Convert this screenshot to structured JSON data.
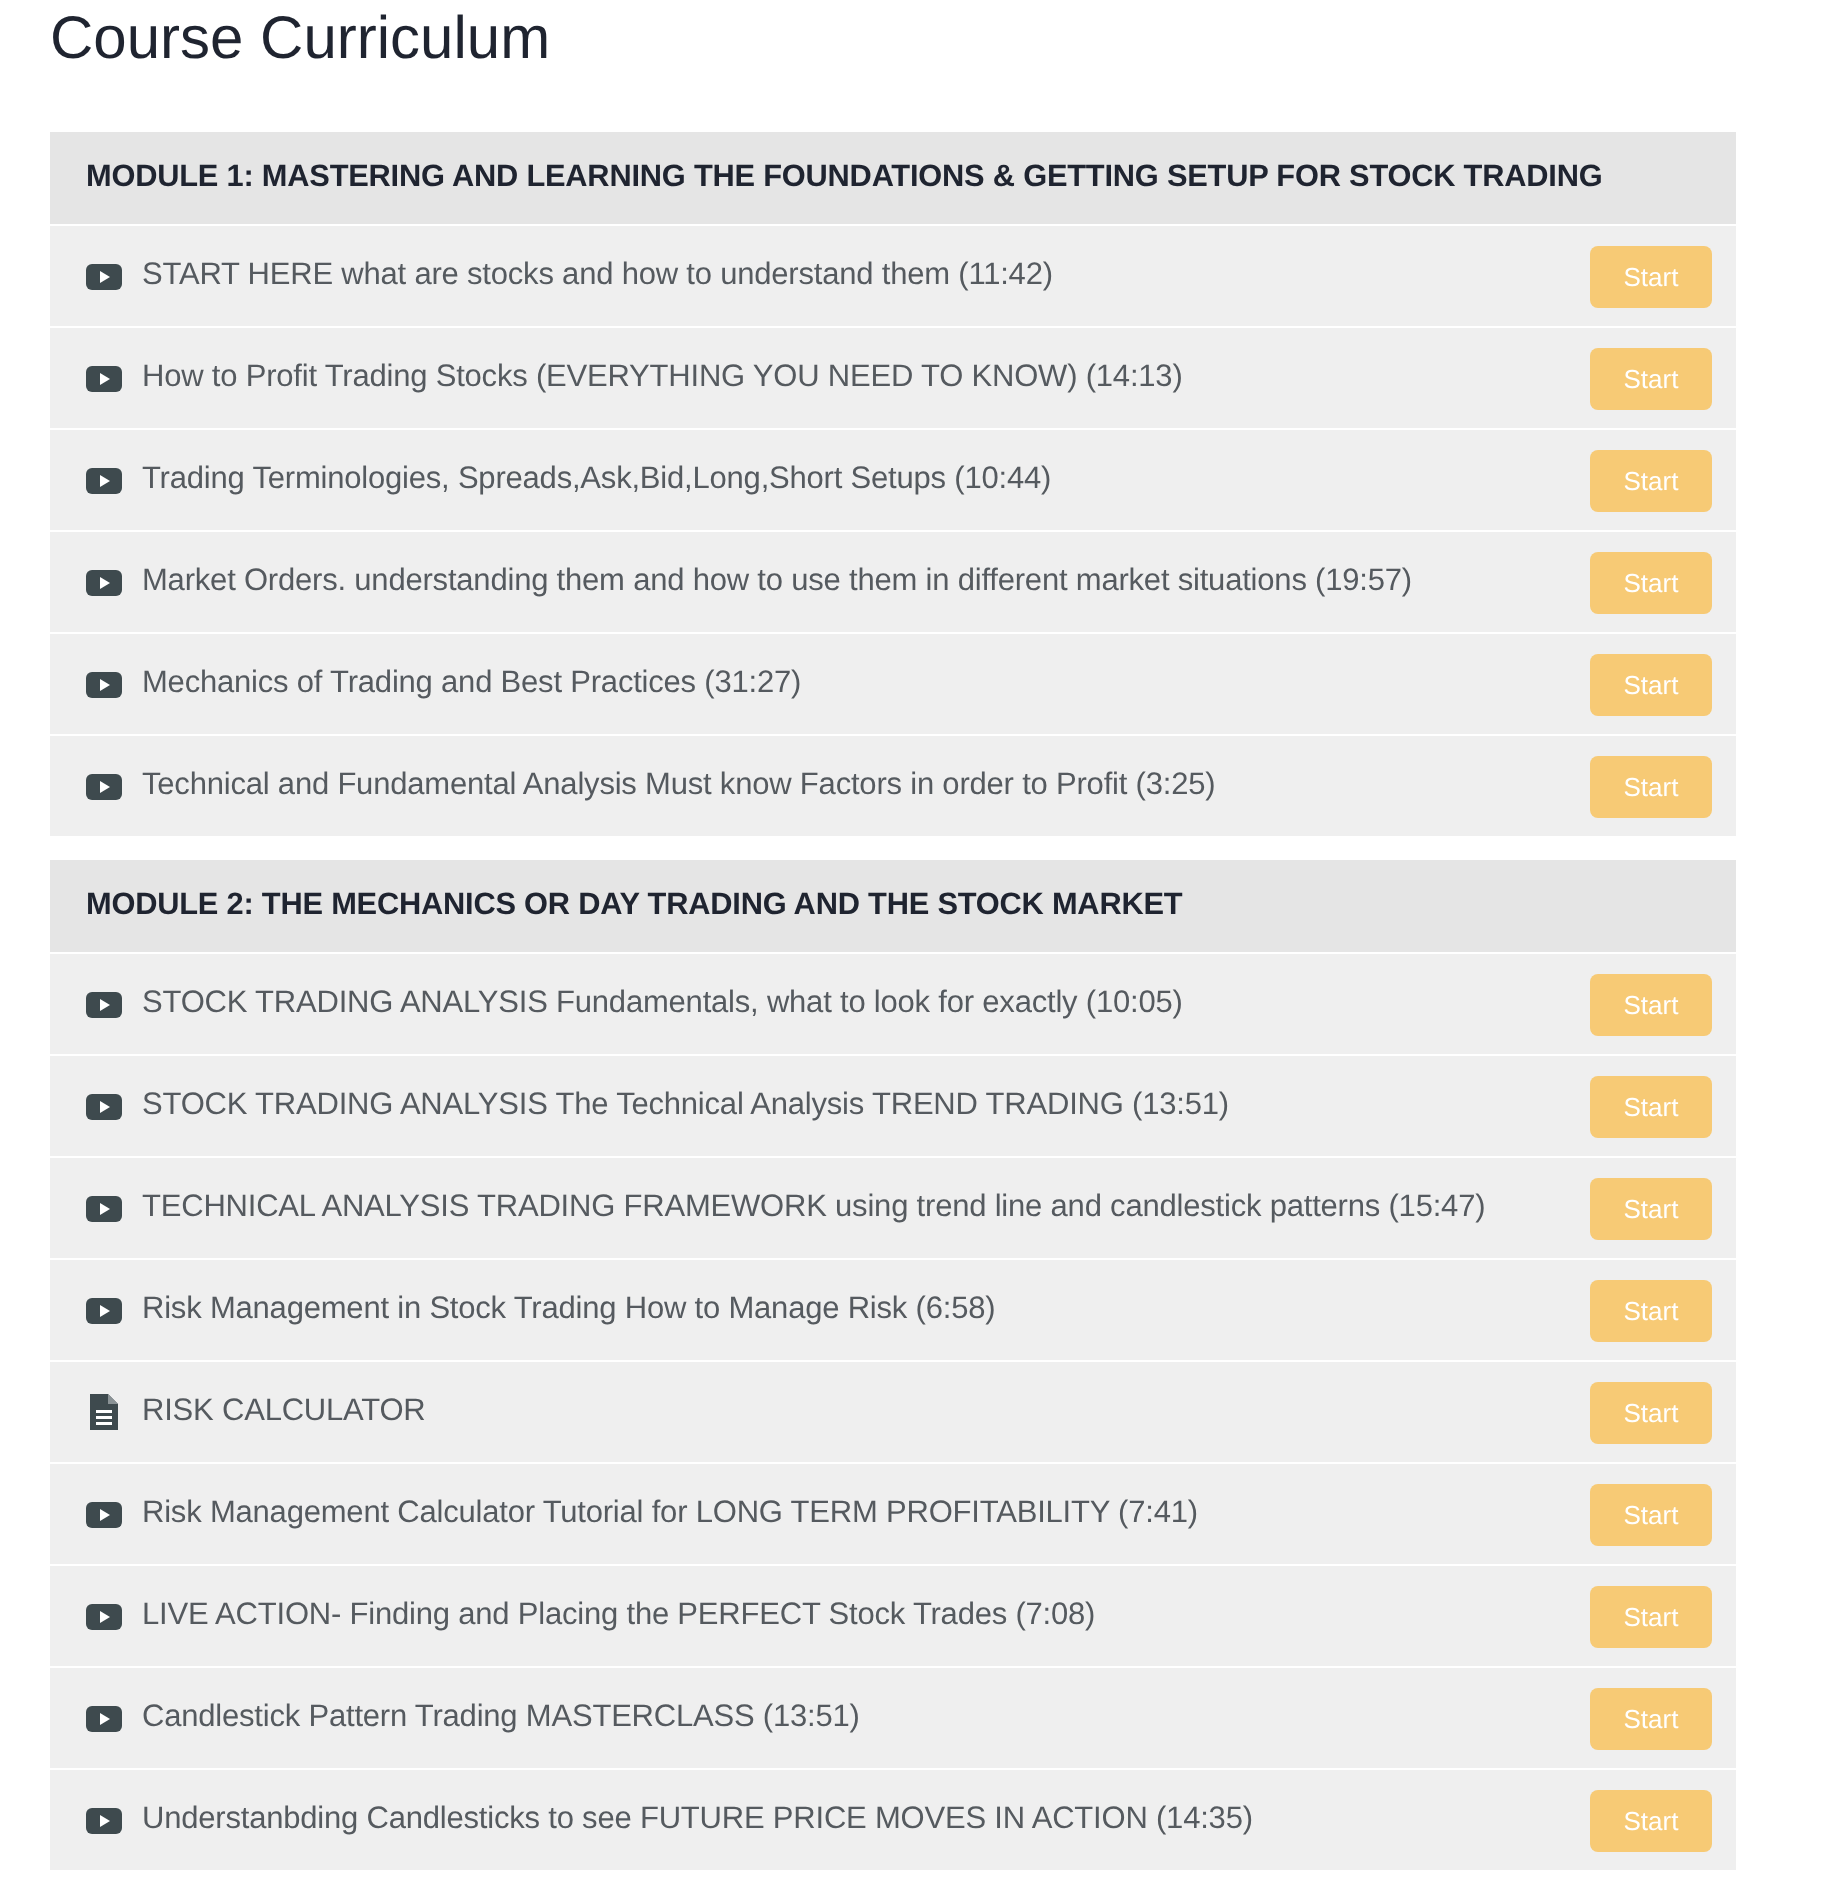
{
  "title": "Course Curriculum",
  "modules": [
    {
      "heading": "MODULE 1: MASTERING AND LEARNING THE FOUNDATIONS & GETTING SETUP FOR STOCK TRADING",
      "lectures": [
        {
          "kind": "video",
          "title": "START HERE what are stocks and how to understand them (11:42)",
          "button": "Start"
        },
        {
          "kind": "video",
          "title": "How to Profit Trading Stocks (EVERYTHING YOU NEED TO KNOW) (14:13)",
          "button": "Start"
        },
        {
          "kind": "video",
          "title": "Trading Terminologies, Spreads,Ask,Bid,Long,Short Setups (10:44)",
          "button": "Start"
        },
        {
          "kind": "video",
          "title": "Market Orders. understanding them and how to use them in different market situations (19:57)",
          "button": "Start"
        },
        {
          "kind": "video",
          "title": "Mechanics of Trading and Best Practices (31:27)",
          "button": "Start"
        },
        {
          "kind": "video",
          "title": "Technical and Fundamental Analysis Must know Factors in order to Profit (3:25)",
          "button": "Start"
        }
      ]
    },
    {
      "heading": "MODULE 2: THE MECHANICS OR DAY TRADING AND THE STOCK MARKET",
      "lectures": [
        {
          "kind": "video",
          "title": "STOCK TRADING ANALYSIS Fundamentals, what to look for exactly (10:05)",
          "button": "Start"
        },
        {
          "kind": "video",
          "title": "STOCK TRADING ANALYSIS The Technical Analysis TREND TRADING (13:51)",
          "button": "Start"
        },
        {
          "kind": "video",
          "title": "TECHNICAL ANALYSIS TRADING FRAMEWORK using trend line and candlestick patterns (15:47)",
          "button": "Start"
        },
        {
          "kind": "video",
          "title": "Risk Management in Stock Trading How to Manage Risk (6:58)",
          "button": "Start"
        },
        {
          "kind": "text",
          "title": "RISK CALCULATOR",
          "button": "Start"
        },
        {
          "kind": "video",
          "title": "Risk Management Calculator Tutorial for LONG TERM PROFITABILITY (7:41)",
          "button": "Start"
        },
        {
          "kind": "video",
          "title": "LIVE ACTION- Finding and Placing the PERFECT Stock Trades (7:08)",
          "button": "Start"
        },
        {
          "kind": "video",
          "title": "Candlestick Pattern Trading MASTERCLASS (13:51)",
          "button": "Start"
        },
        {
          "kind": "video",
          "title": "Understanbding Candlesticks to see FUTURE PRICE MOVES IN ACTION (14:35)",
          "button": "Start"
        }
      ]
    }
  ]
}
